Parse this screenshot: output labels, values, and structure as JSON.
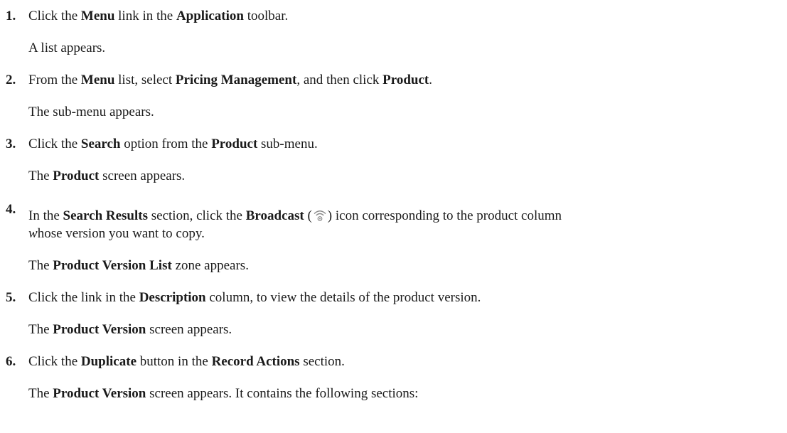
{
  "steps": [
    {
      "number": "1.",
      "text": [
        "Click the ",
        "Menu",
        " link in the ",
        "Application",
        " toolbar."
      ],
      "result": "A list appears."
    },
    {
      "number": "2.",
      "text": [
        "From the ",
        "Menu",
        " list, select ",
        "Pricing Management",
        ", and then click ",
        "Product",
        "."
      ],
      "result": "The sub-menu appears."
    },
    {
      "number": "3.",
      "text": [
        "Click the ",
        "Search",
        " option from the ",
        "Product",
        " sub-menu."
      ],
      "result": [
        "The ",
        "Product",
        " screen appears."
      ]
    },
    {
      "number": "4.",
      "text": [
        "In the ",
        "Search Results",
        " section, click the ",
        "Broadcast",
        " (",
        ") icon corresponding to the product column"
      ],
      "text2": [
        "w",
        "hose version you want to copy."
      ],
      "result": [
        "The ",
        "Product Version List",
        " zone appears."
      ],
      "icon": "broadcast-icon"
    },
    {
      "number": "5.",
      "text": [
        "Click the link in the ",
        "Description",
        " column, to view the details of the product version."
      ],
      "result": [
        "The ",
        "Product Version",
        " screen appears."
      ]
    },
    {
      "number": "6.",
      "text": [
        "Click the ",
        "Duplicate",
        " button in the ",
        "Record Actions",
        " section."
      ],
      "result": [
        "The ",
        "Product Version",
        " screen appears. It contains the following sections:"
      ]
    }
  ]
}
